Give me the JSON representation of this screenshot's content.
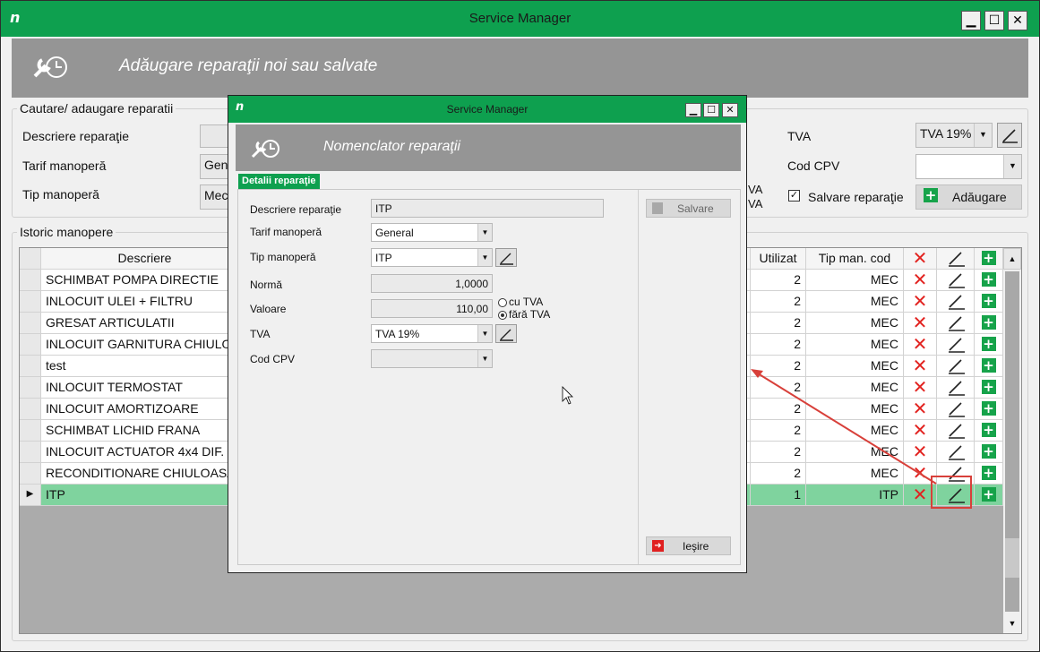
{
  "main_window": {
    "title": "Service Manager",
    "logo": "n",
    "header_title": "Adăugare reparaţii noi sau salvate",
    "controls": {
      "minimize": "▁",
      "maximize": "☐",
      "close": "✕"
    }
  },
  "search_group": {
    "legend": "Cautare/ adaugare reparatii",
    "descriere_label": "Descriere reparaţie",
    "tarif_label": "Tarif manoperă",
    "tip_label": "Tip manoperă",
    "tarif_value_partial": "Gen",
    "tip_value_partial": "Mec",
    "tva_label": "TVA",
    "tva_value": "TVA 19%",
    "cod_cpv_label": "Cod CPV",
    "cod_cpv_value": "",
    "va_partial_1": "VA",
    "va_partial_2": "VA",
    "salvare_checkbox_label": "Salvare reparaţie",
    "salvare_checked": true,
    "adaugare_button": "Adăugare"
  },
  "history": {
    "legend": "Istoric manopere",
    "columns": {
      "descriere": "Descriere",
      "utilizat": "Utilizat",
      "tip_man_cod": "Tip man. cod"
    },
    "rows": [
      {
        "descriere": "SCHIMBAT POMPA DIRECTIE",
        "utilizat": "2",
        "cod": "MEC"
      },
      {
        "descriere": "INLOCUIT ULEI + FILTRU",
        "utilizat": "2",
        "cod": "MEC"
      },
      {
        "descriere": "GRESAT ARTICULATII",
        "utilizat": "2",
        "cod": "MEC"
      },
      {
        "descriere": "INLOCUIT GARNITURA CHIULO",
        "utilizat": "2",
        "cod": "MEC"
      },
      {
        "descriere": "test",
        "utilizat": "2",
        "cod": "MEC"
      },
      {
        "descriere": "INLOCUIT TERMOSTAT",
        "utilizat": "2",
        "cod": "MEC"
      },
      {
        "descriere": "INLOCUIT AMORTIZOARE",
        "utilizat": "2",
        "cod": "MEC"
      },
      {
        "descriere": "SCHIMBAT LICHID FRANA",
        "utilizat": "2",
        "cod": "MEC"
      },
      {
        "descriere": "INLOCUIT ACTUATOR 4x4 DIF.",
        "utilizat": "2",
        "cod": "MEC"
      },
      {
        "descriere": "RECONDITIONARE CHIULOASA",
        "utilizat": "2",
        "cod": "MEC"
      },
      {
        "descriere": "ITP",
        "utilizat": "1",
        "cod": "ITP"
      }
    ],
    "delete_glyph": "✕",
    "add_glyph": "+",
    "row_pointer": "▶",
    "scroll_up": "▲",
    "scroll_down": "▼"
  },
  "dialog": {
    "title": "Service Manager",
    "header_title": "Nomenclator reparaţii",
    "tab": "Detalii reparaţie",
    "descriere_label": "Descriere reparaţie",
    "descriere_value": "ITP",
    "tarif_label": "Tarif manoperă",
    "tarif_value": "General",
    "tip_label": "Tip manoperă",
    "tip_value": "ITP",
    "norma_label": "Normă",
    "norma_value": "1,0000",
    "valoare_label": "Valoare",
    "valoare_value": "110,00",
    "cu_tva": "cu TVA",
    "fara_tva": "fără TVA",
    "tva_label": "TVA",
    "tva_value": "TVA 19%",
    "cod_cpv_label": "Cod CPV",
    "cod_cpv_value": "",
    "salvare_button": "Salvare",
    "iesire_button": "Ieşire"
  },
  "colors": {
    "accent": "#0ea04f",
    "header_grey": "#959595",
    "selected_row": "#7fd39e",
    "delete_red": "#e2221f",
    "annotation_red": "#d8403a"
  }
}
